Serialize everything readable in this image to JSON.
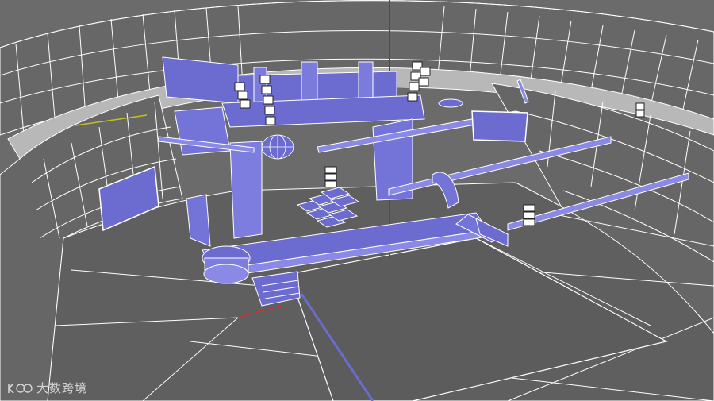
{
  "viewport": {
    "view": "perspective",
    "background_color": "#6b6b6b",
    "floor_color": "#5f5f5f",
    "stand_color": "#6a6a6a",
    "wire_color": "#ffffff",
    "structure_fill": "#6b6bd0",
    "structure_light": "#8a8ae6",
    "z_axis_color": "#2b3bff",
    "x_axis_color": "#d03030",
    "y_axis_color": "#c8c020"
  },
  "scene": {
    "objects": [
      "stadium-stands",
      "stage-roof-truss",
      "led-screen-back",
      "line-array-speaker-left",
      "line-array-speaker-right",
      "side-screen-left",
      "side-screen-right",
      "catwalk",
      "stage-stairs",
      "mixing-deck"
    ]
  },
  "watermark": {
    "text": "大数跨境"
  }
}
